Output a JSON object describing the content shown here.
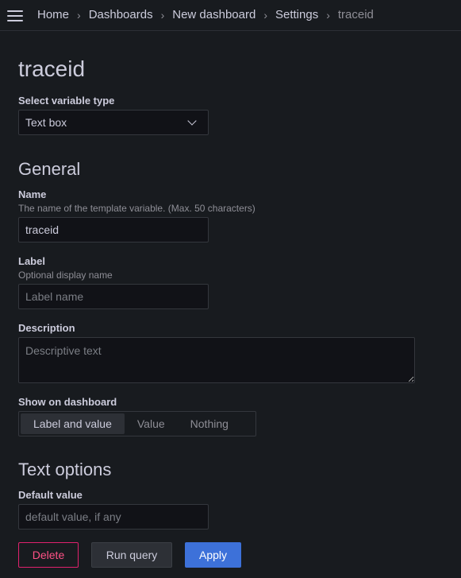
{
  "breadcrumb": {
    "items": [
      "Home",
      "Dashboards",
      "New dashboard",
      "Settings"
    ],
    "current": "traceid"
  },
  "page": {
    "title": "traceid"
  },
  "variable_type": {
    "label": "Select variable type",
    "value": "Text box"
  },
  "general": {
    "title": "General",
    "name": {
      "label": "Name",
      "description": "The name of the template variable. (Max. 50 characters)",
      "value": "traceid"
    },
    "label_field": {
      "label": "Label",
      "description": "Optional display name",
      "placeholder": "Label name"
    },
    "description": {
      "label": "Description",
      "placeholder": "Descriptive text"
    },
    "show_on_dashboard": {
      "label": "Show on dashboard",
      "options": [
        "Label and value",
        "Value",
        "Nothing"
      ],
      "selected": "Label and value"
    }
  },
  "text_options": {
    "title": "Text options",
    "default_value": {
      "label": "Default value",
      "placeholder": "default value, if any"
    }
  },
  "actions": {
    "delete": "Delete",
    "run_query": "Run query",
    "apply": "Apply"
  }
}
